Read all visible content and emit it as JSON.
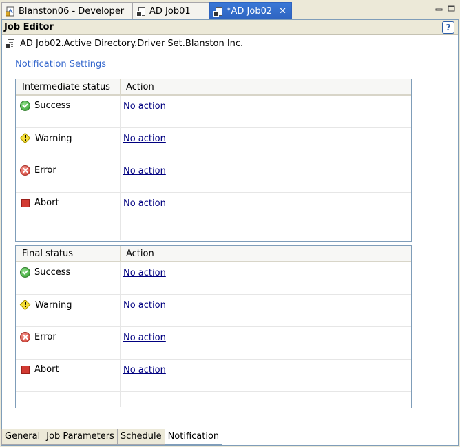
{
  "tabs": [
    {
      "label": "Blanston06 - Developer",
      "active": false,
      "icon": "developer-icon"
    },
    {
      "label": "AD Job01",
      "active": false,
      "icon": "job-icon"
    },
    {
      "label": "*AD Job02",
      "active": true,
      "icon": "job-icon"
    }
  ],
  "tab_close_glyph": "✕",
  "editor": {
    "title": "Job Editor",
    "help_glyph": "?",
    "subject": "AD Job02.Active Directory.Driver Set.Blanston Inc.",
    "section_title": "Notification Settings"
  },
  "intermediate": {
    "header_status": "Intermediate status",
    "header_action": "Action",
    "rows": [
      {
        "status": "Success",
        "icon": "success-icon",
        "action": "No action"
      },
      {
        "status": "Warning",
        "icon": "warning-icon",
        "action": "No action"
      },
      {
        "status": "Error",
        "icon": "error-icon",
        "action": "No action"
      },
      {
        "status": "Abort",
        "icon": "abort-icon",
        "action": "No action"
      }
    ]
  },
  "final": {
    "header_status": "Final status",
    "header_action": "Action",
    "rows": [
      {
        "status": "Success",
        "icon": "success-icon",
        "action": "No action"
      },
      {
        "status": "Warning",
        "icon": "warning-icon",
        "action": "No action"
      },
      {
        "status": "Error",
        "icon": "error-icon",
        "action": "No action"
      },
      {
        "status": "Abort",
        "icon": "abort-icon",
        "action": "No action"
      }
    ]
  },
  "bottom_tabs": [
    {
      "label": "General",
      "active": false
    },
    {
      "label": "Job Parameters",
      "active": false
    },
    {
      "label": "Schedule",
      "active": false
    },
    {
      "label": "Notification",
      "active": true
    }
  ],
  "colors": {
    "active_tab": "#2e63c0",
    "link": "#000080",
    "section_link": "#3366cc",
    "success": "#2f9a2a",
    "warning": "#f7e03a",
    "error": "#d0392e",
    "abort": "#d23a32"
  }
}
